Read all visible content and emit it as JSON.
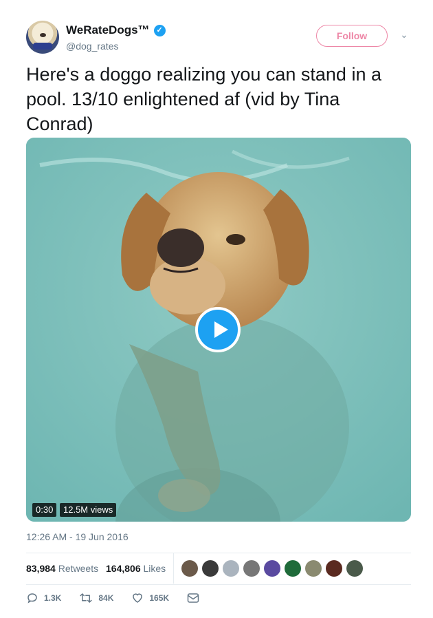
{
  "user": {
    "display_name": "WeRateDogs™",
    "handle": "@dog_rates",
    "verified_icon": "verified-badge-icon"
  },
  "follow_label": "Follow",
  "tweet_text": "Here's a doggo realizing you can stand in a pool. 13/10 enlightened af (vid by Tina Conrad)",
  "video": {
    "duration": "0:30",
    "views": "12.5M views"
  },
  "timestamp": "12:26 AM - 19 Jun 2016",
  "stats": {
    "retweets_count": "83,984",
    "retweets_label": "Retweets",
    "likes_count": "164,806",
    "likes_label": "Likes"
  },
  "liker_colors": [
    "#6b5a4a",
    "#3a3a3a",
    "#aab4be",
    "#777777",
    "#5a4aa0",
    "#1f6b3a",
    "#8a8a70",
    "#5a2a20",
    "#4a5a4a"
  ],
  "actions": {
    "reply_count": "1.3K",
    "retweet_count": "84K",
    "like_count": "165K"
  },
  "colors": {
    "accent": "#1da1f2",
    "follow": "#e0245e",
    "muted": "#657786"
  }
}
